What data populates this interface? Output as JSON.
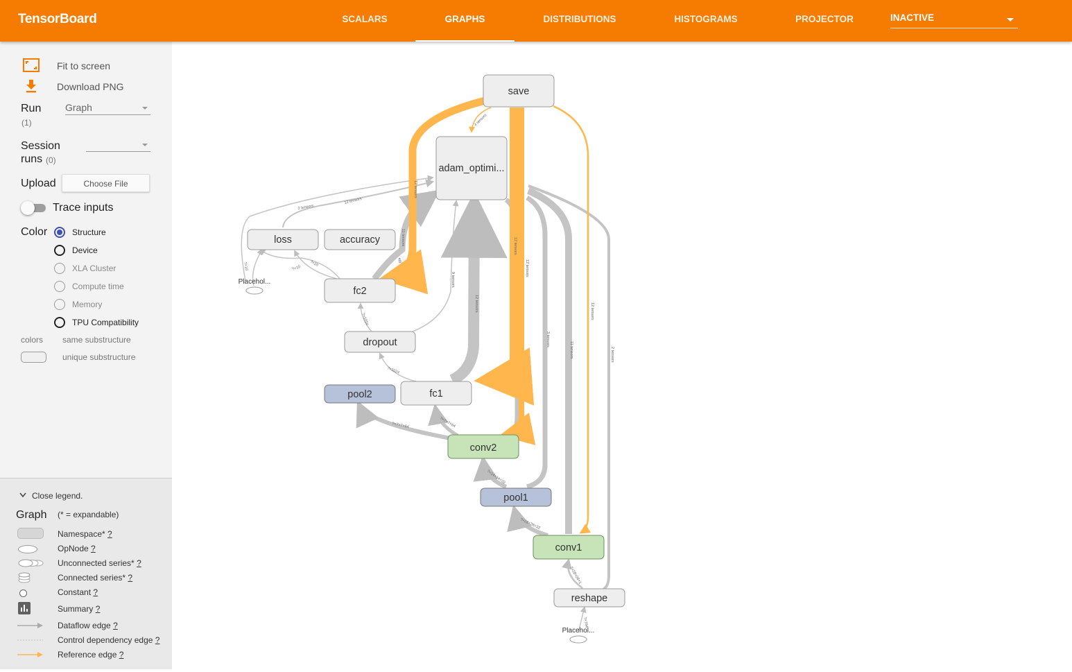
{
  "header": {
    "brand": "TensorBoard",
    "tabs": [
      {
        "label": "SCALARS"
      },
      {
        "label": "GRAPHS",
        "active": true
      },
      {
        "label": "DISTRIBUTIONS"
      },
      {
        "label": "HISTOGRAMS"
      },
      {
        "label": "PROJECTOR"
      }
    ],
    "inactive_select": "INACTIVE",
    "color": "#f57c00"
  },
  "sidebar": {
    "fit_to_screen": "Fit to screen",
    "download_png": "Download PNG",
    "run_label": "Run",
    "run_count": "(1)",
    "run_value": "Graph",
    "session_label_1": "Session",
    "session_label_2": "runs",
    "session_count": "(0)",
    "session_value": "",
    "upload_label": "Upload",
    "choose_file": "Choose File",
    "trace_inputs": "Trace inputs",
    "color_label": "Color",
    "color_options": [
      {
        "label": "Structure",
        "selected": true
      },
      {
        "label": "Device"
      },
      {
        "label": "XLA Cluster"
      },
      {
        "label": "Compute time"
      },
      {
        "label": "Memory"
      },
      {
        "label": "TPU Compatibility"
      }
    ],
    "colors_label": "colors",
    "same_substructure": "same substructure",
    "unique_substructure": "unique substructure"
  },
  "legend": {
    "close": "Close legend.",
    "graph": "Graph",
    "expandable": "(* = expandable)",
    "items": [
      {
        "label": "Namespace*",
        "q": "?"
      },
      {
        "label": "OpNode",
        "q": "?"
      },
      {
        "label": "Unconnected series*",
        "q": "?"
      },
      {
        "label": "Connected series*",
        "q": "?"
      },
      {
        "label": "Constant",
        "q": "?"
      },
      {
        "label": "Summary",
        "q": "?"
      },
      {
        "label": "Dataflow edge",
        "q": "?"
      },
      {
        "label": "Control dependency edge",
        "q": "?"
      },
      {
        "label": "Reference edge",
        "q": "?"
      }
    ]
  },
  "graph": {
    "colors": {
      "namespace": "#eeeeee",
      "pool": "#b6c1da",
      "conv": "#c7e3b8",
      "reference": "#ffb74d",
      "dataflow": "#bdbdbd"
    },
    "nodes": {
      "save": "save",
      "adam": "adam_optimi...",
      "loss": "loss",
      "accuracy": "accuracy",
      "fc2": "fc2",
      "dropout": "dropout",
      "pool2": "pool2",
      "fc1": "fc1",
      "conv2": "conv2",
      "pool1": "pool1",
      "conv1": "conv1",
      "reshape": "reshape",
      "placeholder_top": "Placehol...",
      "placeholder_bottom": "Placehol..."
    },
    "edge_labels": {
      "save_adam": "4 tensors",
      "save_fc2": "12 tensors",
      "save_fc1": "12 tensors",
      "save_conv2": "12 tensors",
      "save_conv1": "12 tensors",
      "adam_fc2": "11 tensors",
      "adam_fc1": "12 tensors",
      "adam_conv2": "3 tensors",
      "adam_conv1": "11 tensors",
      "adam_reshape": "2 tensors",
      "adam_dropout": "9 tensors",
      "loss_adam": "12 tensors",
      "ph_adam": "2 tensors",
      "fc2_acc": "?×10",
      "fc2_loss": "?×10",
      "ph_loss": "?×10",
      "fc2_dropout": "?×1024",
      "dropout_fc1": "?×1024",
      "fc1_conv2": "?×7×7×64",
      "pool2_conv2": "?×7×7×64",
      "conv2_pool1": "?×14×14×32",
      "pool1_conv1": "?×28×28×32",
      "conv1_reshape": "?×28×28×1",
      "reshape_ph": "?×784",
      "fc2_small": "4/8"
    }
  }
}
